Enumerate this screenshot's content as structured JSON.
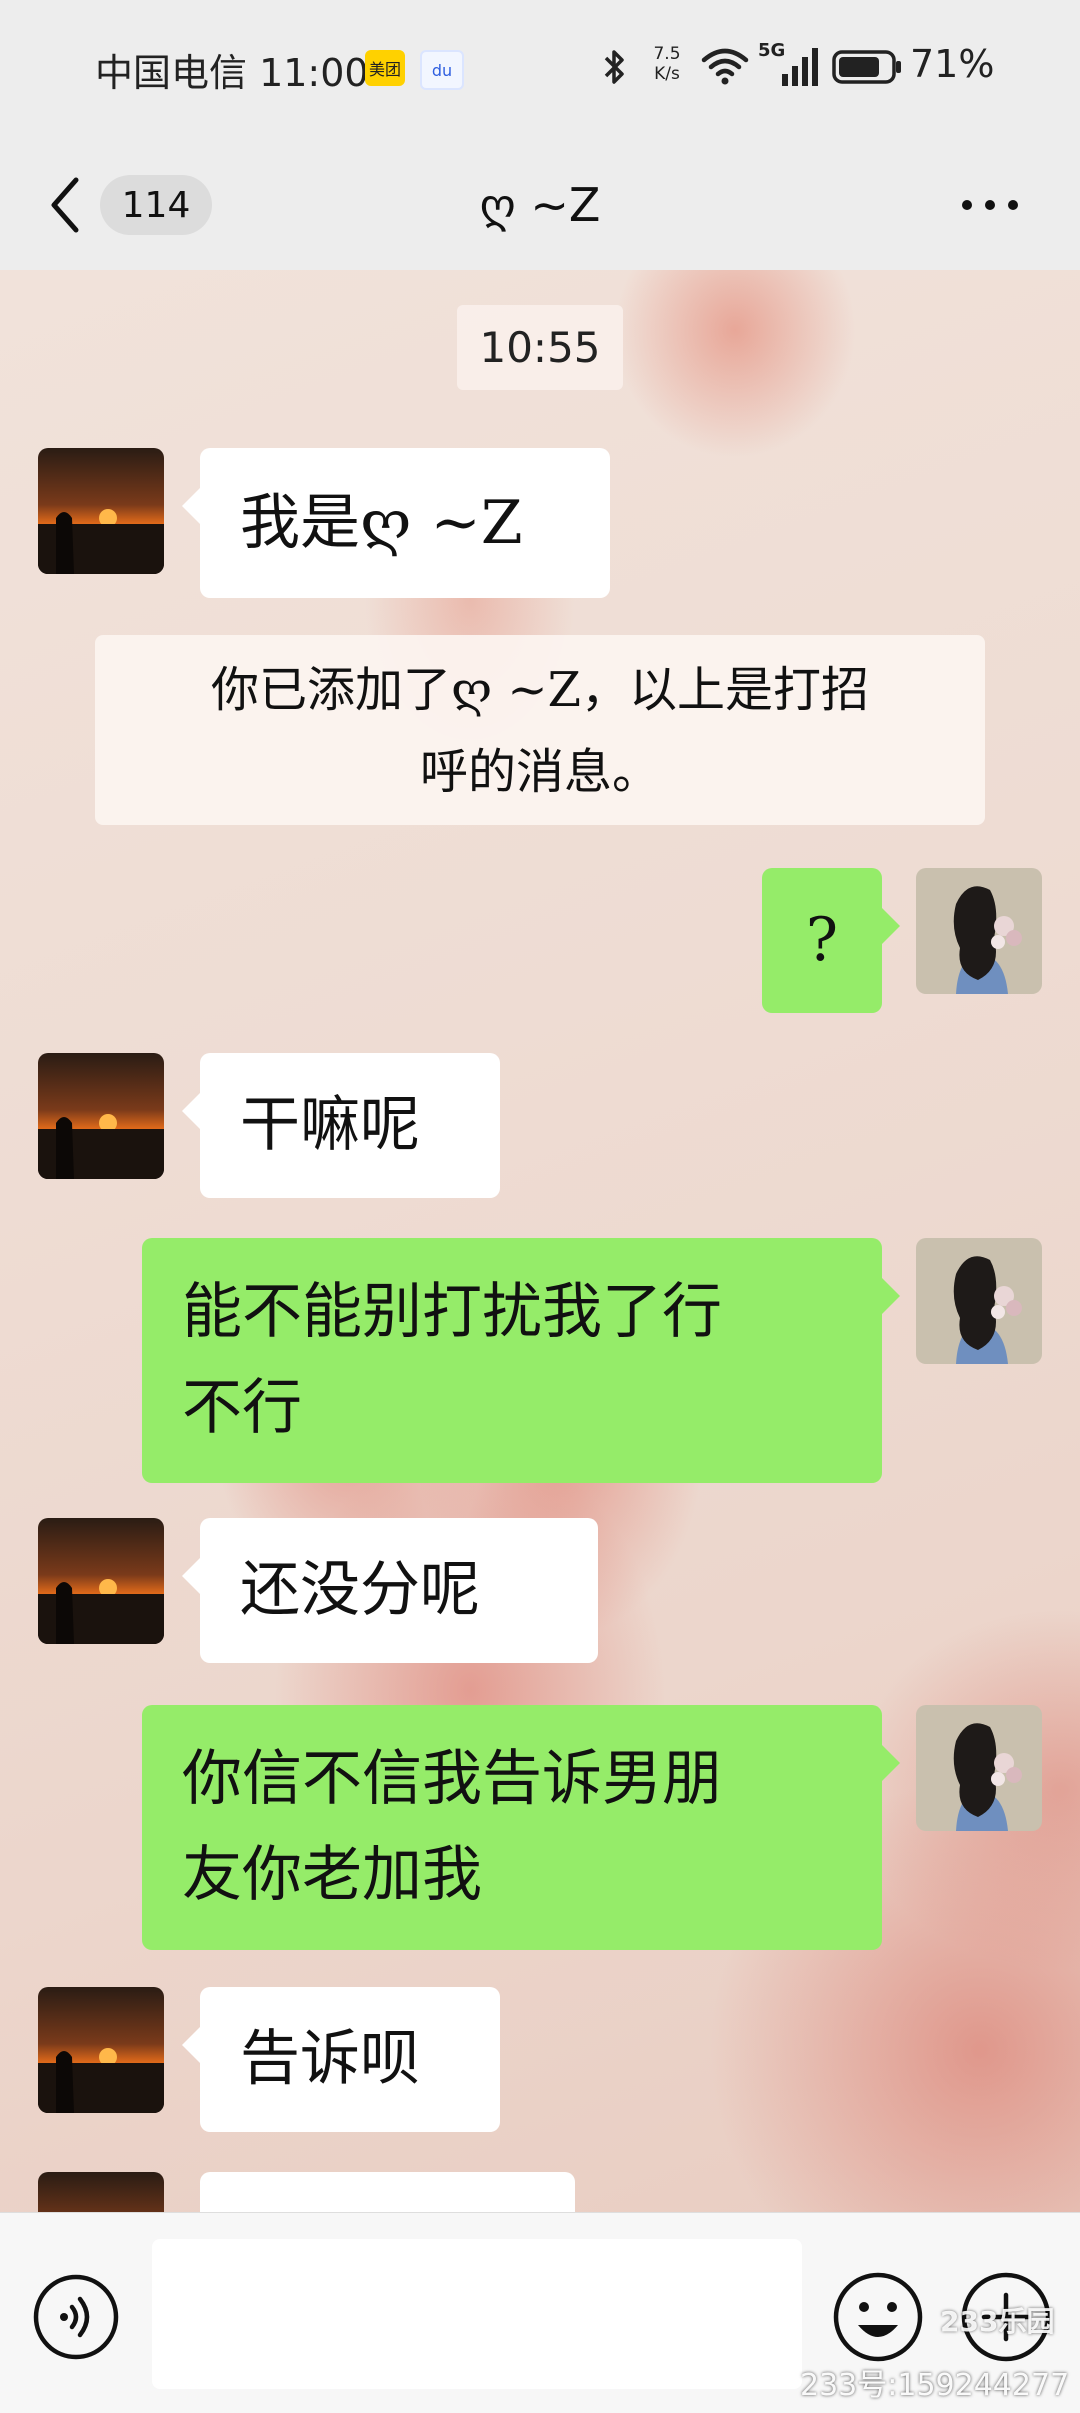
{
  "status_bar": {
    "carrier_time": "中国电信 11:00",
    "meituan_badge": "美团",
    "baidu_badge": "du",
    "net_speed_value": "7.5",
    "net_speed_unit": "K/s",
    "signal_label": "5G",
    "battery": "71%",
    "icons": [
      "bluetooth-icon",
      "wifi-icon",
      "signal-icon",
      "battery-icon"
    ]
  },
  "nav": {
    "unread_count": "114",
    "title": "ღ ~Z",
    "icons": [
      "back-icon",
      "more-icon"
    ]
  },
  "chat": {
    "time": "10:55",
    "messages": [
      {
        "side": "in",
        "text": "我是ღ ~Z"
      },
      {
        "side": "in",
        "text": "干嘛呢"
      },
      {
        "side": "out",
        "text": "?"
      },
      {
        "side": "out",
        "text_line1": "能不能别打扰我了行",
        "text_line2": "不行"
      },
      {
        "side": "in",
        "text": "还没分呢"
      },
      {
        "side": "out",
        "text_line1": "你信不信我告诉男朋",
        "text_line2": "友你老加我"
      },
      {
        "side": "in",
        "text": "告诉呗"
      }
    ],
    "system_notice_line1": "你已添加了ღ ~Z，以上是打招",
    "system_notice_line2": "呼的消息。"
  },
  "input_bar": {
    "input_value": "",
    "icons": [
      "voice-icon",
      "emoji-icon",
      "plus-icon"
    ]
  },
  "watermark": {
    "logo": "233乐园",
    "text": "233号:159244277"
  },
  "colors": {
    "outgoing_bubble": "#95ec69",
    "incoming_bubble": "#ffffff",
    "header_bg": "#ededed"
  }
}
